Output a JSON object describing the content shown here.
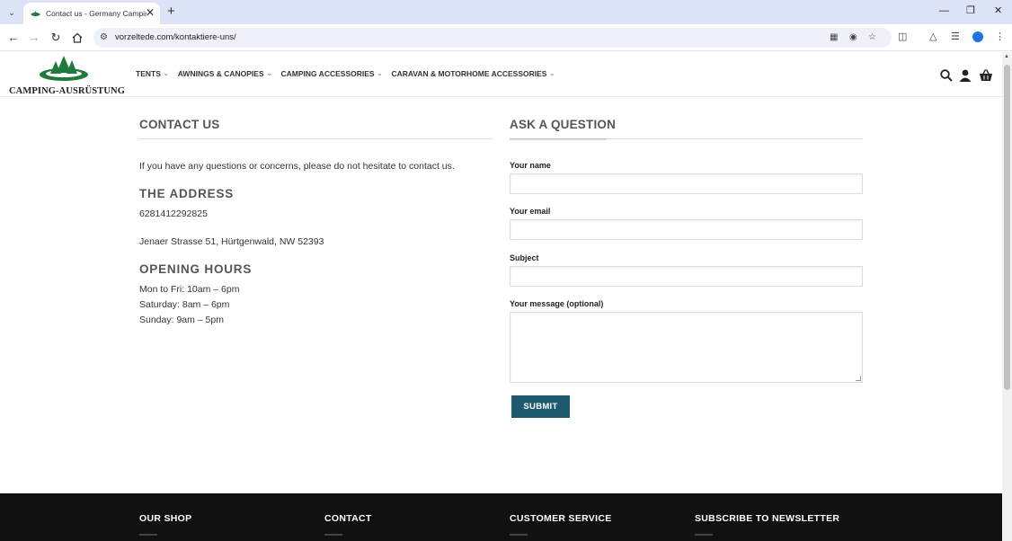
{
  "browser": {
    "tab_title": "Contact us - Germany Camping",
    "url": "vorzeltede.com/kontaktiere-uns/"
  },
  "site": {
    "logo_text": "CAMPING-AUSRÜSTUNG",
    "nav": [
      {
        "label": "TENTS"
      },
      {
        "label": "AWNINGS & CANOPIES"
      },
      {
        "label": "CAMPING ACCESSORIES"
      },
      {
        "label": "CARAVAN & MOTORHOME ACCESSORIES"
      }
    ]
  },
  "contact": {
    "heading": "CONTACT US",
    "intro": "If you have any questions or concerns, please do not hesitate to contact us.",
    "address_heading": "THE ADDRESS",
    "phone": "6281412292825",
    "address": "Jenaer Strasse 51, Hürtgenwald, NW 52393",
    "hours_heading": "OPENING HOURS",
    "hours": [
      "Mon to Fri: 10am – 6pm",
      "Saturday: 8am – 6pm",
      "Sunday: 9am – 5pm"
    ]
  },
  "form": {
    "heading": "ASK A QUESTION",
    "name_label": "Your name",
    "email_label": "Your email",
    "subject_label": "Subject",
    "message_label": "Your message (optional)",
    "submit_label": "SUBMIT"
  },
  "footer": {
    "columns": [
      "OUR SHOP",
      "CONTACT",
      "CUSTOMER SERVICE",
      "SUBSCRIBE TO NEWSLETTER"
    ]
  },
  "colors": {
    "brand_green": "#1f7a3e",
    "button": "#1d5a6e",
    "footer_bg": "#111111"
  }
}
